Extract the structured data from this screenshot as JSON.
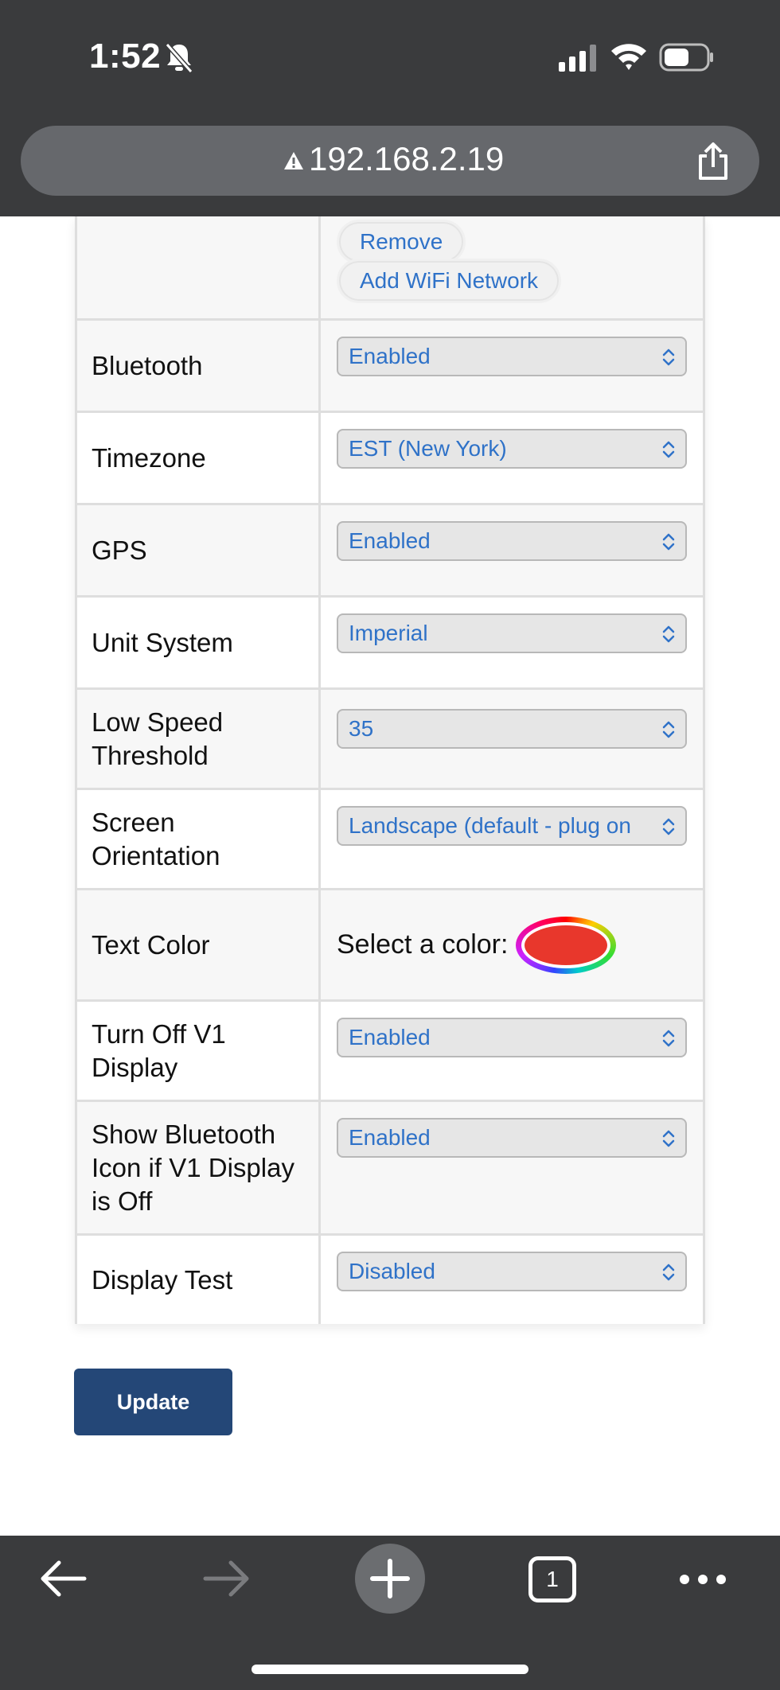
{
  "status_bar": {
    "time": "1:52"
  },
  "browser": {
    "url": "192.168.2.19"
  },
  "wifi_actions": {
    "remove_label": "Remove",
    "add_label": "Add WiFi Network"
  },
  "settings": [
    {
      "label": "Bluetooth",
      "value": "Enabled"
    },
    {
      "label": "Timezone",
      "value": "EST (New York)"
    },
    {
      "label": "GPS",
      "value": "Enabled"
    },
    {
      "label": "Unit System",
      "value": "Imperial"
    },
    {
      "label": "Low Speed Threshold",
      "value": "35"
    },
    {
      "label": "Screen Orientation",
      "value": "Landscape (default - plug on"
    },
    {
      "label": "Text Color",
      "prompt": "Select a color:",
      "color": "#e8372c"
    },
    {
      "label": "Turn Off V1 Display",
      "value": "Enabled"
    },
    {
      "label": "Show Bluetooth Icon if V1 Display is Off",
      "value": "Enabled"
    },
    {
      "label": "Display Test",
      "value": "Disabled"
    }
  ],
  "update_label": "Update",
  "toolbar": {
    "tab_count": "1"
  },
  "colors": {
    "accent": "#2f72c8",
    "button": "#244777",
    "chrome": "#3a3b3d"
  }
}
